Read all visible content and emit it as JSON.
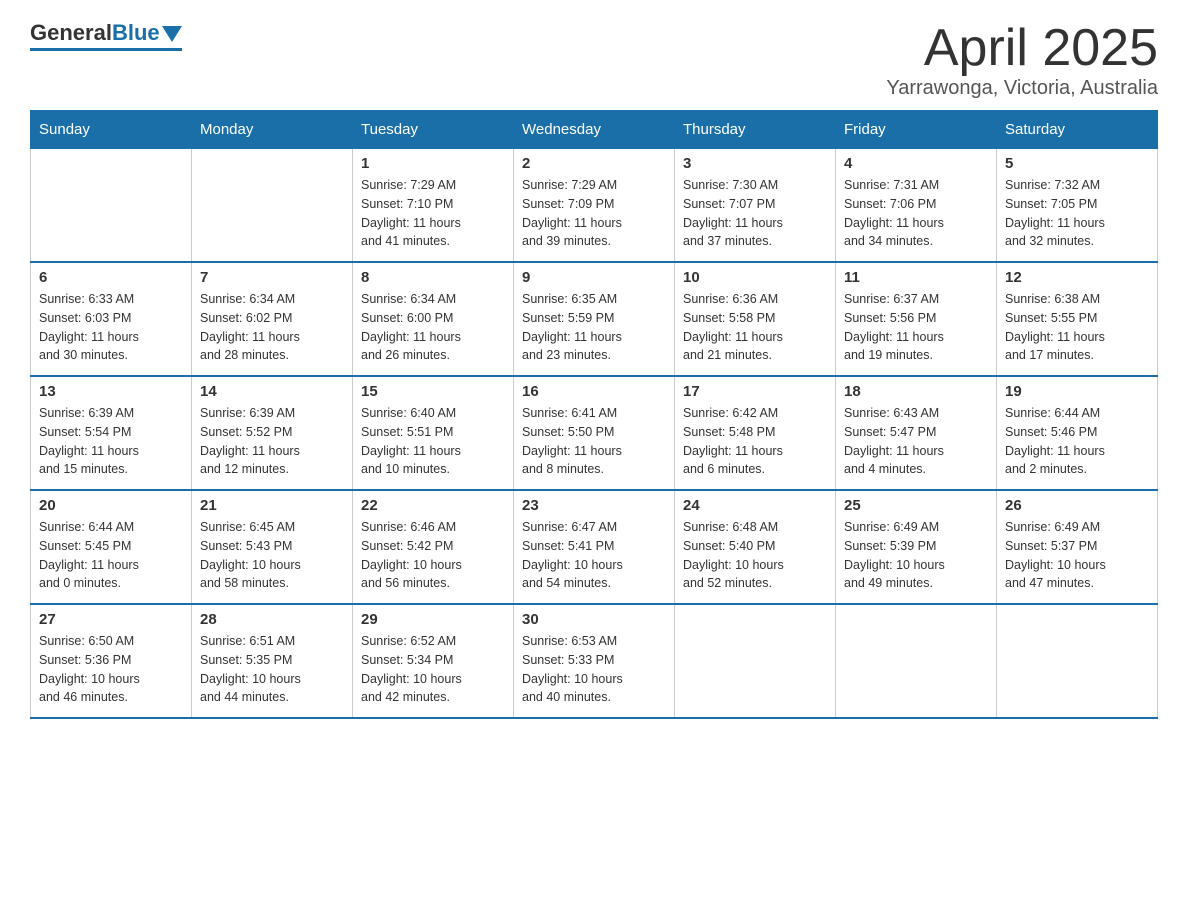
{
  "header": {
    "logo_general": "General",
    "logo_blue": "Blue",
    "title": "April 2025",
    "subtitle": "Yarrawonga, Victoria, Australia"
  },
  "calendar": {
    "days_of_week": [
      "Sunday",
      "Monday",
      "Tuesday",
      "Wednesday",
      "Thursday",
      "Friday",
      "Saturday"
    ],
    "weeks": [
      [
        {
          "day": "",
          "info": ""
        },
        {
          "day": "",
          "info": ""
        },
        {
          "day": "1",
          "info": "Sunrise: 7:29 AM\nSunset: 7:10 PM\nDaylight: 11 hours\nand 41 minutes."
        },
        {
          "day": "2",
          "info": "Sunrise: 7:29 AM\nSunset: 7:09 PM\nDaylight: 11 hours\nand 39 minutes."
        },
        {
          "day": "3",
          "info": "Sunrise: 7:30 AM\nSunset: 7:07 PM\nDaylight: 11 hours\nand 37 minutes."
        },
        {
          "day": "4",
          "info": "Sunrise: 7:31 AM\nSunset: 7:06 PM\nDaylight: 11 hours\nand 34 minutes."
        },
        {
          "day": "5",
          "info": "Sunrise: 7:32 AM\nSunset: 7:05 PM\nDaylight: 11 hours\nand 32 minutes."
        }
      ],
      [
        {
          "day": "6",
          "info": "Sunrise: 6:33 AM\nSunset: 6:03 PM\nDaylight: 11 hours\nand 30 minutes."
        },
        {
          "day": "7",
          "info": "Sunrise: 6:34 AM\nSunset: 6:02 PM\nDaylight: 11 hours\nand 28 minutes."
        },
        {
          "day": "8",
          "info": "Sunrise: 6:34 AM\nSunset: 6:00 PM\nDaylight: 11 hours\nand 26 minutes."
        },
        {
          "day": "9",
          "info": "Sunrise: 6:35 AM\nSunset: 5:59 PM\nDaylight: 11 hours\nand 23 minutes."
        },
        {
          "day": "10",
          "info": "Sunrise: 6:36 AM\nSunset: 5:58 PM\nDaylight: 11 hours\nand 21 minutes."
        },
        {
          "day": "11",
          "info": "Sunrise: 6:37 AM\nSunset: 5:56 PM\nDaylight: 11 hours\nand 19 minutes."
        },
        {
          "day": "12",
          "info": "Sunrise: 6:38 AM\nSunset: 5:55 PM\nDaylight: 11 hours\nand 17 minutes."
        }
      ],
      [
        {
          "day": "13",
          "info": "Sunrise: 6:39 AM\nSunset: 5:54 PM\nDaylight: 11 hours\nand 15 minutes."
        },
        {
          "day": "14",
          "info": "Sunrise: 6:39 AM\nSunset: 5:52 PM\nDaylight: 11 hours\nand 12 minutes."
        },
        {
          "day": "15",
          "info": "Sunrise: 6:40 AM\nSunset: 5:51 PM\nDaylight: 11 hours\nand 10 minutes."
        },
        {
          "day": "16",
          "info": "Sunrise: 6:41 AM\nSunset: 5:50 PM\nDaylight: 11 hours\nand 8 minutes."
        },
        {
          "day": "17",
          "info": "Sunrise: 6:42 AM\nSunset: 5:48 PM\nDaylight: 11 hours\nand 6 minutes."
        },
        {
          "day": "18",
          "info": "Sunrise: 6:43 AM\nSunset: 5:47 PM\nDaylight: 11 hours\nand 4 minutes."
        },
        {
          "day": "19",
          "info": "Sunrise: 6:44 AM\nSunset: 5:46 PM\nDaylight: 11 hours\nand 2 minutes."
        }
      ],
      [
        {
          "day": "20",
          "info": "Sunrise: 6:44 AM\nSunset: 5:45 PM\nDaylight: 11 hours\nand 0 minutes."
        },
        {
          "day": "21",
          "info": "Sunrise: 6:45 AM\nSunset: 5:43 PM\nDaylight: 10 hours\nand 58 minutes."
        },
        {
          "day": "22",
          "info": "Sunrise: 6:46 AM\nSunset: 5:42 PM\nDaylight: 10 hours\nand 56 minutes."
        },
        {
          "day": "23",
          "info": "Sunrise: 6:47 AM\nSunset: 5:41 PM\nDaylight: 10 hours\nand 54 minutes."
        },
        {
          "day": "24",
          "info": "Sunrise: 6:48 AM\nSunset: 5:40 PM\nDaylight: 10 hours\nand 52 minutes."
        },
        {
          "day": "25",
          "info": "Sunrise: 6:49 AM\nSunset: 5:39 PM\nDaylight: 10 hours\nand 49 minutes."
        },
        {
          "day": "26",
          "info": "Sunrise: 6:49 AM\nSunset: 5:37 PM\nDaylight: 10 hours\nand 47 minutes."
        }
      ],
      [
        {
          "day": "27",
          "info": "Sunrise: 6:50 AM\nSunset: 5:36 PM\nDaylight: 10 hours\nand 46 minutes."
        },
        {
          "day": "28",
          "info": "Sunrise: 6:51 AM\nSunset: 5:35 PM\nDaylight: 10 hours\nand 44 minutes."
        },
        {
          "day": "29",
          "info": "Sunrise: 6:52 AM\nSunset: 5:34 PM\nDaylight: 10 hours\nand 42 minutes."
        },
        {
          "day": "30",
          "info": "Sunrise: 6:53 AM\nSunset: 5:33 PM\nDaylight: 10 hours\nand 40 minutes."
        },
        {
          "day": "",
          "info": ""
        },
        {
          "day": "",
          "info": ""
        },
        {
          "day": "",
          "info": ""
        }
      ]
    ]
  }
}
